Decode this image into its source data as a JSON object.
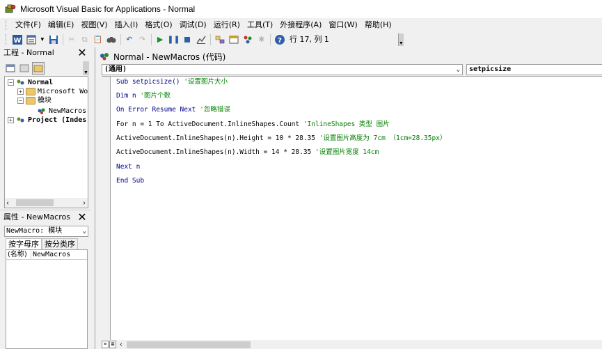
{
  "window": {
    "title": "Microsoft Visual Basic for Applications - Normal"
  },
  "menu": [
    "文件(F)",
    "编辑(E)",
    "视图(V)",
    "插入(I)",
    "格式(O)",
    "调试(D)",
    "运行(R)",
    "工具(T)",
    "外接程序(A)",
    "窗口(W)",
    "帮助(H)"
  ],
  "toolbar": {
    "position": "行 17, 列 1"
  },
  "project_panel": {
    "title": "工程 - Normal",
    "close": "✕",
    "tree": [
      {
        "label": "Normal",
        "toggle": "−"
      },
      {
        "label": "Microsoft Wor",
        "toggle": "+"
      },
      {
        "label": "模块",
        "toggle": "−"
      },
      {
        "label": "NewMacros",
        "toggle": ""
      },
      {
        "label": "Project (Indes",
        "toggle": "+"
      }
    ]
  },
  "properties_panel": {
    "title": "属性 - NewMacros",
    "close": "✕",
    "object": "NewMacro: 模块",
    "tabs": [
      "按字母序",
      "按分类序"
    ],
    "rows": [
      {
        "name": "(名称)",
        "value": "NewMacros"
      }
    ]
  },
  "code_window": {
    "title": "Normal - NewMacros (代码)",
    "object_combo": "(通用)",
    "proc_combo": "setpicsize",
    "lines": [
      {
        "code": "Sub setpicsize() ",
        "comment": "'设置图片大小"
      },
      {
        "code": "Dim n ",
        "comment": "'图片个数"
      },
      {
        "code": "On Error Resume Next ",
        "comment": "'忽略错误"
      },
      {
        "code": "For n = 1 To ActiveDocument.InlineShapes.Count ",
        "comment": "'InlineShapes 类型 图片"
      },
      {
        "code": "ActiveDocument.InlineShapes(n).Height = 10 * 28.35 ",
        "comment": "'设置图片高度为 7cm （1cm=28.35px）"
      },
      {
        "code": "ActiveDocument.InlineShapes(n).Width = 14 * 28.35 ",
        "comment": "'设置图片宽度 14cm"
      },
      {
        "code": "Next n",
        "comment": ""
      },
      {
        "code": "End Sub",
        "comment": ""
      }
    ]
  },
  "colors": {
    "keyword": "#00008b",
    "comment": "#008000"
  }
}
